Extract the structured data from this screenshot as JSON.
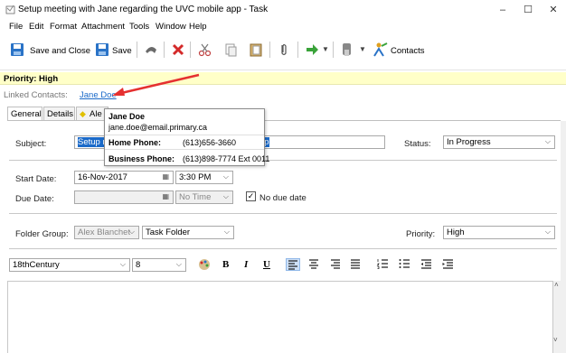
{
  "window": {
    "title": "Setup meeting with Jane regarding the UVC mobile app - Task",
    "minimize": "–",
    "maximize": "☐",
    "close": "✕"
  },
  "menu": [
    "File",
    "Edit",
    "Format",
    "Attachment",
    "Tools",
    "Window",
    "Help"
  ],
  "toolbar": {
    "save_close": "Save and Close",
    "save": "Save",
    "contacts": "Contacts"
  },
  "priority_bar": {
    "text": "Priority: High"
  },
  "linked": {
    "label": "Linked Contacts:",
    "contact": "Jane Doe"
  },
  "tabs": {
    "general": "General",
    "details": "Details",
    "alerts": "Ale"
  },
  "tooltip": {
    "name": "Jane Doe",
    "email": "jane.doe@email.primary.ca",
    "home_label": "Home Phone:",
    "home_value": "(613)656-3660",
    "business_label": "Business Phone:",
    "business_value": "(613)898-7774 Ext 0011"
  },
  "form": {
    "subject_label": "Subject:",
    "subject_value_start": "Setup m",
    "subject_value_end": "pp",
    "status_label": "Status:",
    "status_value": "In Progress",
    "start_label": "Start Date:",
    "start_date": "16-Nov-2017",
    "start_time": "3:30 PM",
    "due_label": "Due Date:",
    "due_time": "No Time",
    "no_due_label": "No due date",
    "folder_group_label": "Folder Group:",
    "folder_group_value": "Alex Blanchet",
    "folder_value": "Task Folder",
    "priority_label": "Priority:",
    "priority_value": "High"
  },
  "format": {
    "font": "18thCentury",
    "size": "8",
    "bold": "B",
    "italic": "I",
    "underline": "U"
  },
  "colors": {
    "accent": "#1b6ac9",
    "priority_bg": "#ffffc8",
    "arrow": "#e53030"
  }
}
